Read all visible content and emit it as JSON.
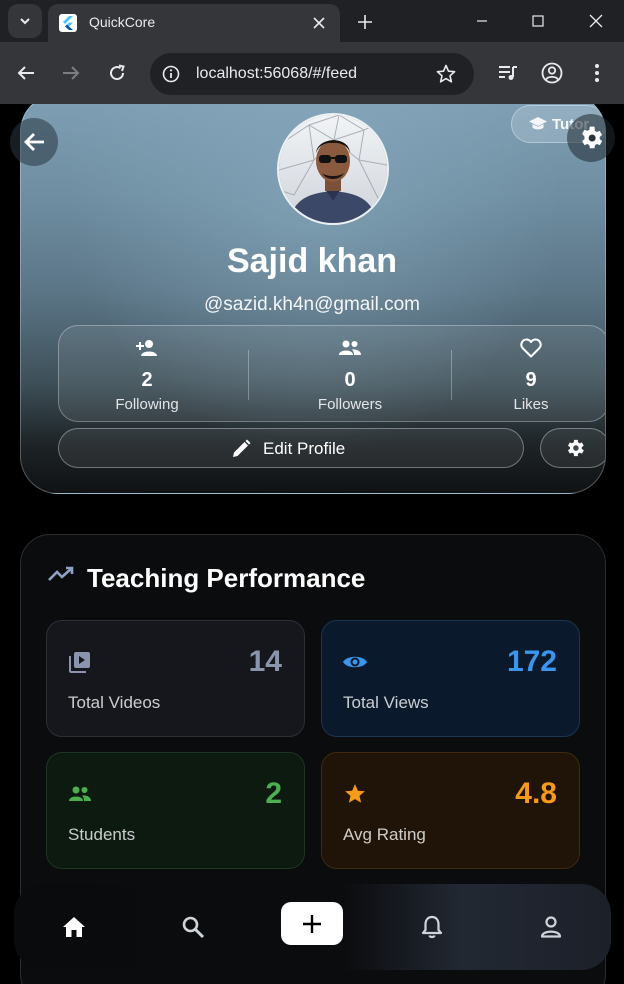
{
  "browser": {
    "tab_title": "QuickCore",
    "url": "localhost:56068/#/feed"
  },
  "profile": {
    "role_chip": "Tutor",
    "name": "Sajid khan",
    "email": "@sazid.kh4n@gmail.com",
    "stats": [
      {
        "value": "2",
        "label": "Following",
        "icon": "person-add-icon"
      },
      {
        "value": "0",
        "label": "Followers",
        "icon": "group-icon"
      },
      {
        "value": "9",
        "label": "Likes",
        "icon": "heart-icon"
      }
    ],
    "edit_label": "Edit Profile"
  },
  "performance": {
    "title": "Teaching Performance",
    "metrics": [
      {
        "value": "14",
        "label": "Total Videos",
        "icon": "video-library-icon",
        "color": "#8a95ad"
      },
      {
        "value": "172",
        "label": "Total Views",
        "icon": "eye-icon",
        "color": "#3a95ee"
      },
      {
        "value": "2",
        "label": "Students",
        "icon": "group-icon",
        "color": "#4caf50"
      },
      {
        "value": "4.8",
        "label": "Avg Rating",
        "icon": "star-icon",
        "color": "#f59a1d"
      }
    ]
  },
  "nav": [
    "home-icon",
    "search-icon",
    "add-icon",
    "bell-icon",
    "person-icon"
  ]
}
